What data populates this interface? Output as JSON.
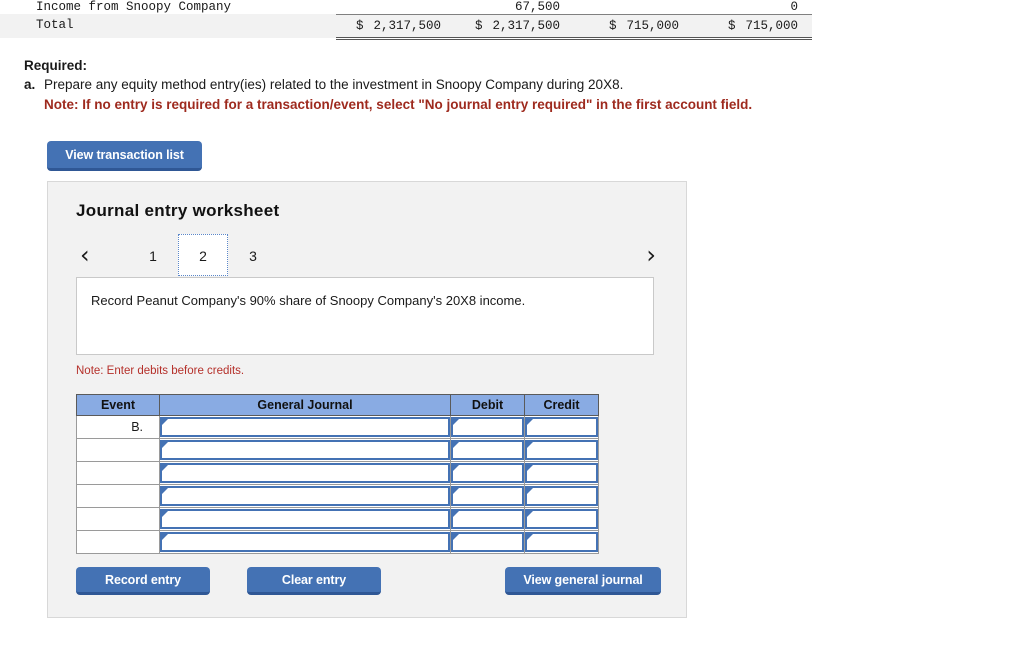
{
  "top_table": {
    "columns": 4,
    "partial_row": {
      "label": "Income from Snoopy Company",
      "values": [
        "",
        "67,500",
        "",
        "0"
      ]
    },
    "total_row": {
      "label": "Total",
      "values": [
        {
          "symbol": "$",
          "amount": "2,317,500"
        },
        {
          "symbol": "$",
          "amount": "2,317,500"
        },
        {
          "symbol": "$",
          "amount": "715,000"
        },
        {
          "symbol": "$",
          "amount": "715,000"
        }
      ]
    }
  },
  "required": {
    "title": "Required:",
    "item_letter": "a.",
    "item_text": "Prepare any equity method entry(ies) related to the investment in Snoopy Company during 20X8.",
    "note": "Note: If no entry is required for a transaction/event, select \"No journal entry required\" in the first account field.",
    "note_color": "#9e2a1e"
  },
  "buttons": {
    "view_transaction_list": "View transaction list",
    "record_entry": "Record entry",
    "clear_entry": "Clear entry",
    "view_general_journal": "View general journal",
    "accent_color": "#4472b4"
  },
  "worksheet": {
    "title": "Journal entry worksheet",
    "pager": {
      "prev_icon": "chevron-left",
      "next_icon": "chevron-right",
      "prev_glyph": "‹",
      "next_glyph": "›",
      "pages": [
        "1",
        "2",
        "3"
      ],
      "active_page": "2"
    },
    "description": "Record Peanut Company's 90% share of Snoopy Company's 20X8 income.",
    "debit_note": "Note: Enter debits before credits.",
    "debit_note_color": "#b5302a",
    "table": {
      "headers": [
        "Event",
        "General Journal",
        "Debit",
        "Credit"
      ],
      "header_color": "#89ABE3",
      "rows": [
        {
          "event": "B.",
          "journal": "",
          "debit": "",
          "credit": ""
        },
        {
          "event": "",
          "journal": "",
          "debit": "",
          "credit": ""
        },
        {
          "event": "",
          "journal": "",
          "debit": "",
          "credit": ""
        },
        {
          "event": "",
          "journal": "",
          "debit": "",
          "credit": ""
        },
        {
          "event": "",
          "journal": "",
          "debit": "",
          "credit": ""
        },
        {
          "event": "",
          "journal": "",
          "debit": "",
          "credit": ""
        }
      ]
    }
  }
}
